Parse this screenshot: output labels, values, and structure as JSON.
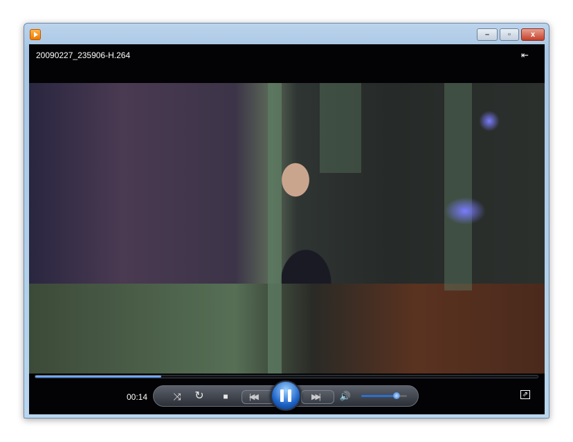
{
  "window": {
    "file_name": "20090227_235906-H.264",
    "minimize_label": "–",
    "maximize_label": "▫",
    "close_label": "x"
  },
  "playback": {
    "current_time": "00:14",
    "progress_percent": 25,
    "volume_percent": 78,
    "state": "playing"
  },
  "icons": {
    "shuffle": "⤨",
    "repeat": "↻",
    "stop": "■",
    "prev": "|◀◀",
    "next": "▶▶|",
    "volume": "🔊",
    "fullscreen": "⇗",
    "compact": "⇤"
  }
}
